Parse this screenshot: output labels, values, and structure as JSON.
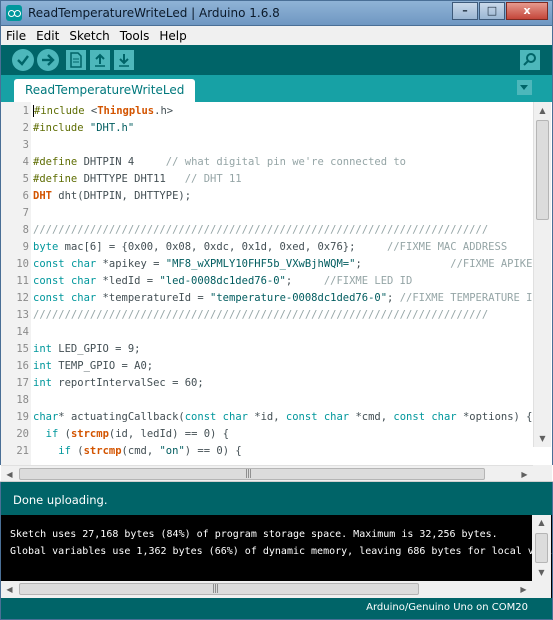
{
  "window": {
    "title": "ReadTemperatureWriteLed | Arduino 1.6.8",
    "minimize_glyph": "–",
    "maximize_glyph": "□",
    "close_glyph": "x"
  },
  "menu": {
    "items": [
      "File",
      "Edit",
      "Sketch",
      "Tools",
      "Help"
    ]
  },
  "toolbar": {
    "verify_icon": "check-icon",
    "upload_icon": "arrow-right-icon",
    "new_icon": "new-file-icon",
    "open_icon": "arrow-up-icon",
    "save_icon": "arrow-down-icon",
    "serial_monitor_icon": "magnifier-icon",
    "accent_color": "#4db7bb",
    "bar_color": "#006468"
  },
  "tabs": {
    "active": "ReadTemperatureWriteLed"
  },
  "editor": {
    "lines": [
      {
        "n": "1",
        "html": "<span class=\"caret\"></span><span class=\"pp\">#include</span> &lt;<span class=\"cls\">Thingplus</span>.h&gt;"
      },
      {
        "n": "2",
        "html": "<span class=\"pp\">#include</span> <span class=\"str\">\"DHT.h\"</span>"
      },
      {
        "n": "3",
        "html": ""
      },
      {
        "n": "4",
        "html": "<span class=\"pp\">#define</span> DHTPIN 4     <span class=\"cm\">// what digital pin we're connected to</span>"
      },
      {
        "n": "5",
        "html": "<span class=\"pp\">#define</span> DHTTYPE DHT11   <span class=\"cm\">// DHT 11</span>"
      },
      {
        "n": "6",
        "html": "<span class=\"cls\">DHT</span> dht(DHTPIN, DHTTYPE);"
      },
      {
        "n": "7",
        "html": ""
      },
      {
        "n": "8",
        "html": "<span class=\"cm\">////////////////////////////////////////////////////////////////////////</span>"
      },
      {
        "n": "9",
        "html": "<span class=\"kw\">byte</span> mac[6] = {0x00, 0x08, 0xdc, 0x1d, 0xed, 0x76};     <span class=\"cm\">//FIXME MAC ADDRESS</span>"
      },
      {
        "n": "10",
        "html": "<span class=\"kw\">const</span> <span class=\"kw\">char</span> *apikey = <span class=\"str\">\"MF8_wXPMLY10FHF5b_VXwBjhWQM=\"</span>;              <span class=\"cm\">//FIXME APIKEY</span>"
      },
      {
        "n": "11",
        "html": "<span class=\"kw\">const</span> <span class=\"kw\">char</span> *ledId = <span class=\"str\">\"led-0008dc1ded76-0\"</span>;     <span class=\"cm\">//FIXME LED ID</span>"
      },
      {
        "n": "12",
        "html": "<span class=\"kw\">const</span> <span class=\"kw\">char</span> *temperatureId = <span class=\"str\">\"temperature-0008dc1ded76-0\"</span>; <span class=\"cm\">//FIXME TEMPERATURE ID</span>"
      },
      {
        "n": "13",
        "html": "<span class=\"cm\">////////////////////////////////////////////////////////////////////////</span>"
      },
      {
        "n": "14",
        "html": ""
      },
      {
        "n": "15",
        "html": "<span class=\"kw\">int</span> LED_GPIO = 9;"
      },
      {
        "n": "16",
        "html": "<span class=\"kw\">int</span> TEMP_GPIO = A0;"
      },
      {
        "n": "17",
        "html": "<span class=\"kw\">int</span> reportIntervalSec = 60;"
      },
      {
        "n": "18",
        "html": ""
      },
      {
        "n": "19",
        "html": "<span class=\"kw\">char</span>* actuatingCallback(<span class=\"kw\">const</span> <span class=\"kw\">char</span> *id, <span class=\"kw\">const</span> <span class=\"kw\">char</span> *cmd, <span class=\"kw\">const</span> <span class=\"kw\">char</span> *options) {"
      },
      {
        "n": "20",
        "html": "  <span class=\"kw\">if</span> (<span class=\"cls\">strcmp</span>(id, ledId) == 0) {"
      },
      {
        "n": "21",
        "html": "    <span class=\"kw\">if</span> (<span class=\"cls\">strcmp</span>(cmd, <span class=\"str\">\"on\"</span>) == 0) {"
      }
    ]
  },
  "status": {
    "message": "Done uploading."
  },
  "console": {
    "lines": [
      "Sketch uses 27,168 bytes (84%) of program storage space. Maximum is 32,256 bytes.",
      "Global variables use 1,362 bytes (66%) of dynamic memory, leaving 686 bytes for local variables. M"
    ]
  },
  "footer": {
    "board": "Arduino/Genuino Uno on COM20"
  }
}
